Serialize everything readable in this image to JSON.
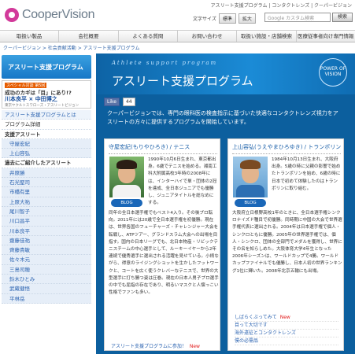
{
  "header": {
    "logo_text": "CooperVision",
    "top_links": "アスリート支援プログラム | コンタクトレンズ | クーパービジョン",
    "font_size_label": "文字サイズ",
    "font_normal": "標準",
    "font_large": "拡大",
    "search_placeholder": "Google カスタム検索",
    "search_button": "検索"
  },
  "gnav": [
    "取扱い製品",
    "会社概要",
    "よくある質問",
    "お問い合わせ",
    "取扱い施設・店舗検索",
    "医療従事者向け専門情報"
  ],
  "breadcrumb": "クーパービジョン > 社会貢献活動 > アスリート支援プログラム",
  "sidebar": {
    "title": "アスリート支援プログラム",
    "promo": {
      "badge": "スペシャル対談 第5回",
      "line1": "成功のカギは「目」にあり!?",
      "line2": "川本良平 × 中田博之",
      "line3": "東京ヤクルトスワローズ・アスリートビジョン"
    },
    "items": [
      "アスリート支援プログラムとは",
      "プログラム詳細",
      "支援アスリート",
      "守屋宏紀",
      "上山容弘",
      "過去にご紹介したアスリート",
      "井原勝",
      "石光堅司",
      "市橋有里",
      "上原大祐",
      "尾川智子",
      "川口昌平",
      "川本良平",
      "齋藤佳祐",
      "齊藤貴敏",
      "佐々木元",
      "三島司穂",
      "鈴木ひとみ",
      "武蔵健悟",
      "平林岳"
    ]
  },
  "main": {
    "hero_en": "Athlete support program",
    "hero_title": "アスリート支援プログラム",
    "badge_text": "POWER OF VISION",
    "like_label": "Like",
    "like_count": "44",
    "intro": "クーパービジョンでは、専門の眼科医の検査指示に基づいた快適なコンタクトレンズ視力をアスリートの方々に提供するプログラムを開始しています。",
    "athletes": [
      {
        "name": "守屋宏紀(もりやひろき) / テニス",
        "blog": "BLOG",
        "bio_side": "1990年10月6日生まれ、東京都出身。6歳でテニスを始める。湘南工科大附属高校3年時の2008年には、インターハイで単・団体の2冠を達成、全日本ジュニアでも優勝し、ジュニアタイトルを総なめにする。",
        "bio_full": "同年の全日本選手権でもベスト4入り。その後プロ転向。2011年には20歳で全日本選手権を初優勝。現在は、世界各国のフューチャーズ・チャレンジャー大会を転戦し、ATPツアー、グランドスラム大会への出場を目指す。国内の日本リーグでも、北日本物産・リビックテニスチームの中心選手として、ルーキーイヤーから2年連続で優秀選手に選出される活躍を見せている。小柄ながら、得意のライジングショットを生かしたフットワークと、コートを広く使うクレバーなテニスで、世界の大型選手に打ち勝つ姿は圧巻。現在の日本人男子プロ選手の中でも屈指の存在であり、明るいマスクと人懐っこい性格でファンも多い。",
        "link": "アスリート支援プログラムに参加！",
        "new": "New"
      },
      {
        "name": "上山容弘(うえやまひろゆき) / トランポリン",
        "blog": "BLOG",
        "bio_side": "1984年10月13日生まれ、大阪府出身。5歳の時に父親の影響で始めたトランポリンを始め、6歳の時に日本で初めて体験したのはトランポリンに取り組む。",
        "bio_full": "大阪府立日根野高校1年のときに、全日本選手権シンクロナイズド種目で初優勝。同時期に中国の大会で世界選手権代表に選出される。2004年は日本選手権で個人・シンクロともに優勝。2005年の世界選手権では、個人・シンクロ、団体の全部門でメダルを獲得し、世界にその名を知らしめた。大阪体育大学4年生となった2006年シーズンは、ワールドカップで4勝。ワールドカップファイナルでも優勝し、日本人初の世界ランキング1位に輝いた。2008年北京五輪にも出場。",
        "links": [
          "しばらくぶってみて",
          "目って大切です",
          "海外遠征とコンタクトレンズ",
          "僕の必需品"
        ],
        "new": "New"
      }
    ]
  }
}
